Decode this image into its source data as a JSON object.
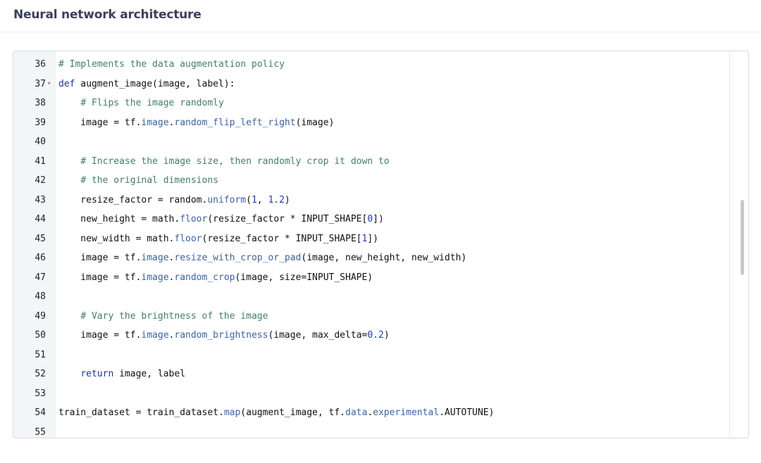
{
  "header": {
    "title": "Neural network architecture"
  },
  "editor": {
    "lines": [
      {
        "n": "36",
        "tokens": [
          [
            "comment",
            "# Implements the data augmentation policy"
          ]
        ]
      },
      {
        "n": "37",
        "fold": true,
        "tokens": [
          [
            "kw",
            "def"
          ],
          [
            "plain",
            " augment_image(image, label):"
          ]
        ]
      },
      {
        "n": "38",
        "tokens": [
          [
            "plain",
            "    "
          ],
          [
            "comment",
            "# Flips the image randomly"
          ]
        ]
      },
      {
        "n": "39",
        "tokens": [
          [
            "plain",
            "    image = tf."
          ],
          [
            "fn",
            "image"
          ],
          [
            "plain",
            "."
          ],
          [
            "fn",
            "random_flip_left_right"
          ],
          [
            "plain",
            "(image)"
          ]
        ]
      },
      {
        "n": "40",
        "tokens": []
      },
      {
        "n": "41",
        "tokens": [
          [
            "plain",
            "    "
          ],
          [
            "comment",
            "# Increase the image size, then randomly crop it down to"
          ]
        ]
      },
      {
        "n": "42",
        "tokens": [
          [
            "plain",
            "    "
          ],
          [
            "comment",
            "# the original dimensions"
          ]
        ]
      },
      {
        "n": "43",
        "tokens": [
          [
            "plain",
            "    resize_factor = random."
          ],
          [
            "fn",
            "uniform"
          ],
          [
            "plain",
            "("
          ],
          [
            "num",
            "1"
          ],
          [
            "plain",
            ", "
          ],
          [
            "num",
            "1.2"
          ],
          [
            "plain",
            ")"
          ]
        ]
      },
      {
        "n": "44",
        "tokens": [
          [
            "plain",
            "    new_height = math."
          ],
          [
            "fn",
            "floor"
          ],
          [
            "plain",
            "(resize_factor * INPUT_SHAPE["
          ],
          [
            "num",
            "0"
          ],
          [
            "plain",
            "])"
          ]
        ]
      },
      {
        "n": "45",
        "tokens": [
          [
            "plain",
            "    new_width = math."
          ],
          [
            "fn",
            "floor"
          ],
          [
            "plain",
            "(resize_factor * INPUT_SHAPE["
          ],
          [
            "num",
            "1"
          ],
          [
            "plain",
            "])"
          ]
        ]
      },
      {
        "n": "46",
        "tokens": [
          [
            "plain",
            "    image = tf."
          ],
          [
            "fn",
            "image"
          ],
          [
            "plain",
            "."
          ],
          [
            "fn",
            "resize_with_crop_or_pad"
          ],
          [
            "plain",
            "(image, new_height, new_width)"
          ]
        ]
      },
      {
        "n": "47",
        "tokens": [
          [
            "plain",
            "    image = tf."
          ],
          [
            "fn",
            "image"
          ],
          [
            "plain",
            "."
          ],
          [
            "fn",
            "random_crop"
          ],
          [
            "plain",
            "(image, size=INPUT_SHAPE)"
          ]
        ]
      },
      {
        "n": "48",
        "tokens": []
      },
      {
        "n": "49",
        "tokens": [
          [
            "plain",
            "    "
          ],
          [
            "comment",
            "# Vary the brightness of the image"
          ]
        ]
      },
      {
        "n": "50",
        "tokens": [
          [
            "plain",
            "    image = tf."
          ],
          [
            "fn",
            "image"
          ],
          [
            "plain",
            "."
          ],
          [
            "fn",
            "random_brightness"
          ],
          [
            "plain",
            "(image, max_delta="
          ],
          [
            "num",
            "0.2"
          ],
          [
            "plain",
            ")"
          ]
        ]
      },
      {
        "n": "51",
        "tokens": []
      },
      {
        "n": "52",
        "tokens": [
          [
            "plain",
            "    "
          ],
          [
            "kw",
            "return"
          ],
          [
            "plain",
            " image, label"
          ]
        ]
      },
      {
        "n": "53",
        "tokens": []
      },
      {
        "n": "54",
        "tokens": [
          [
            "plain",
            "train_dataset = train_dataset."
          ],
          [
            "fn",
            "map"
          ],
          [
            "plain",
            "(augment_image, tf."
          ],
          [
            "fn",
            "data"
          ],
          [
            "plain",
            "."
          ],
          [
            "fn",
            "experimental"
          ],
          [
            "plain",
            ".AUTOTUNE)"
          ]
        ]
      },
      {
        "n": "55",
        "tokens": []
      }
    ]
  }
}
